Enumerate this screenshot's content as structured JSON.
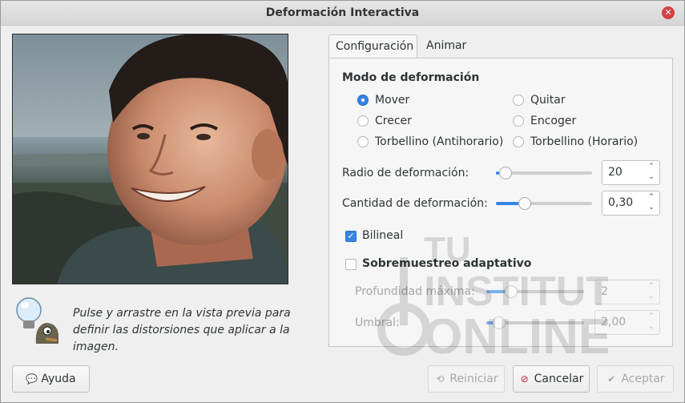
{
  "window": {
    "title": "Deformación Interactiva"
  },
  "hint": {
    "text": "Pulse y arrastre en la vista previa para definir las distorsiones que aplicar a la imagen."
  },
  "tabs": [
    {
      "label": "Configuración"
    },
    {
      "label": "Animar"
    }
  ],
  "mode": {
    "title": "Modo de deformación",
    "options": [
      {
        "label": "Mover",
        "selected": true
      },
      {
        "label": "Quitar",
        "selected": false
      },
      {
        "label": "Crecer",
        "selected": false
      },
      {
        "label": "Encoger",
        "selected": false
      },
      {
        "label": "Torbellino (Antihorario)",
        "selected": false
      },
      {
        "label": "Torbellino (Horario)",
        "selected": false
      }
    ]
  },
  "radius": {
    "label": "Radio de deformación:",
    "value": "20",
    "level": 0.03
  },
  "amount": {
    "label": "Cantidad de deformación:",
    "value": "0,30",
    "level": 0.3
  },
  "bilinear": {
    "label": "Bilineal",
    "checked": true
  },
  "supersample": {
    "label": "Sobremuestreo adaptativo",
    "checked": false,
    "depth": {
      "label": "Profundidad máxima:",
      "value": "2",
      "level": 0.25
    },
    "threshold": {
      "label": "Umbral:",
      "value": "2,00",
      "level": 0.13
    }
  },
  "buttons": {
    "help": "Ayuda",
    "reset": "Reiniciar",
    "cancel": "Cancelar",
    "ok": "Aceptar"
  },
  "watermark": {
    "line1": "TU",
    "line2": "INSTITUTO",
    "line3": "ONLINE"
  },
  "colors": {
    "accent": "#3584e4",
    "close": "#d64040"
  }
}
